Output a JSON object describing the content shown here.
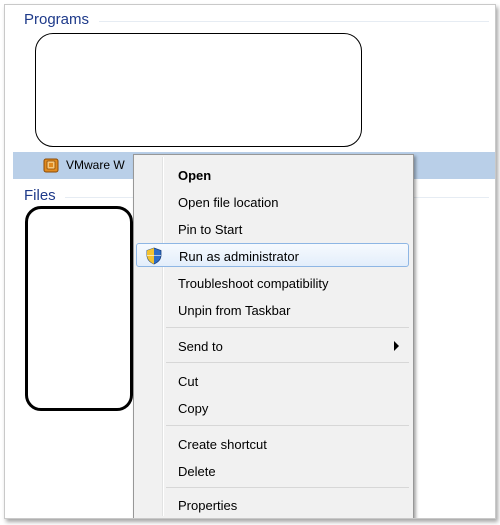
{
  "sections": {
    "programs_title": "Programs",
    "files_title": "Files"
  },
  "program_row": {
    "label": "VMware W"
  },
  "context_menu": {
    "items": [
      {
        "label": "Open"
      },
      {
        "label": "Open file location"
      },
      {
        "label": "Pin to Start"
      },
      {
        "label": "Run as administrator",
        "icon": "uac-shield-icon"
      },
      {
        "label": "Troubleshoot compatibility"
      },
      {
        "label": "Unpin from Taskbar"
      },
      {
        "label": "Send to",
        "submenu": true
      },
      {
        "label": "Cut"
      },
      {
        "label": "Copy"
      },
      {
        "label": "Create shortcut"
      },
      {
        "label": "Delete"
      },
      {
        "label": "Properties"
      }
    ]
  },
  "colors": {
    "section_title": "#1e3a8a",
    "selected_row": "#b9cfe8",
    "menu_background": "#f1f1f1",
    "hover_border": "#8eb6e4"
  }
}
